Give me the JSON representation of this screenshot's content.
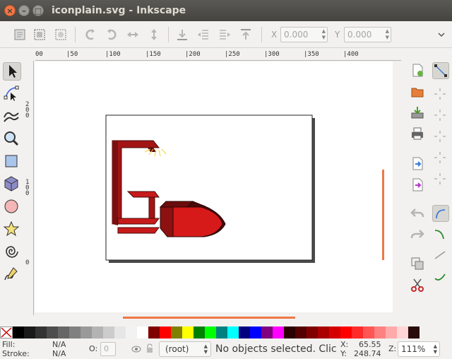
{
  "window": {
    "title": "iconplain.svg - Inkscape",
    "close": "×",
    "minimize": "–",
    "maximize": "□"
  },
  "toolbar": {
    "icons": [
      "select-all-icon",
      "select-all-layers-icon",
      "deselect-icon",
      "rotate-ccw-icon",
      "rotate-cw-icon",
      "flip-horizontal-icon",
      "flip-vertical-icon",
      "lower-to-bottom-icon",
      "lower-icon",
      "raise-icon",
      "raise-to-top-icon"
    ],
    "x_label": "X",
    "x_value": "0.000",
    "y_label": "Y",
    "y_value": "0.000"
  },
  "hruler": {
    "labels": [
      "00",
      "|50",
      "|100",
      "|150",
      "|200",
      "|250",
      "|300",
      "|350",
      "|400"
    ]
  },
  "vruler": {
    "labels": [
      "200",
      "100",
      "0"
    ]
  },
  "tools": [
    "selector-tool-icon",
    "node-tool-icon",
    "tweak-tool-icon",
    "zoom-tool-icon",
    "rectangle-tool-icon",
    "3d-box-tool-icon",
    "ellipse-tool-icon",
    "star-tool-icon",
    "spiral-tool-icon",
    "pencil-tool-icon"
  ],
  "commands": [
    "new-document-icon",
    "open-document-icon",
    "import-icon",
    "print-icon",
    "export-icon",
    "open-export-icon",
    "undo-icon",
    "redo-icon",
    "duplicate-icon",
    "cut-icon"
  ],
  "snaps": [
    "snap-toggle-icon",
    "snap-bbox-icon",
    "snap-nodes-icon",
    "snap-path-icon",
    "snap-intersection-icon",
    "snap-cusp-icon",
    "snap-smooth-icon",
    "snap-midpoint-icon",
    "snap-center-icon",
    "snap-rotation-icon"
  ],
  "palette": [
    "#000000",
    "#1a1a1a",
    "#333333",
    "#4d4d4d",
    "#666666",
    "#808080",
    "#999999",
    "#b3b3b3",
    "#cccccc",
    "#e6e6e6",
    "#f2f2f2",
    "#ffffff",
    "#800000",
    "#ff0000",
    "#808000",
    "#ffff00",
    "#008000",
    "#00ff00",
    "#008080",
    "#00ffff",
    "#000080",
    "#0000ff",
    "#800080",
    "#ff00ff",
    "#2b0000",
    "#550000",
    "#800000",
    "#aa0000",
    "#d40000",
    "#ff0000",
    "#ff2a2a",
    "#ff5555",
    "#ff8080",
    "#ffaaaa",
    "#ffd5d5",
    "#280b0b"
  ],
  "status": {
    "fill_label": "Fill:",
    "fill_value": "N/A",
    "stroke_label": "Stroke:",
    "stroke_value": "N/A",
    "opacity_label": "O:",
    "opacity_value": "0",
    "layer": "(root)",
    "message": "No objects selected. Clic...",
    "x_label": "X:",
    "x_value": "65.55",
    "y_label": "Y:",
    "y_value": "248.74",
    "zoom_label": "Z:",
    "zoom_value": "111%"
  },
  "accent_color": "#f07746"
}
